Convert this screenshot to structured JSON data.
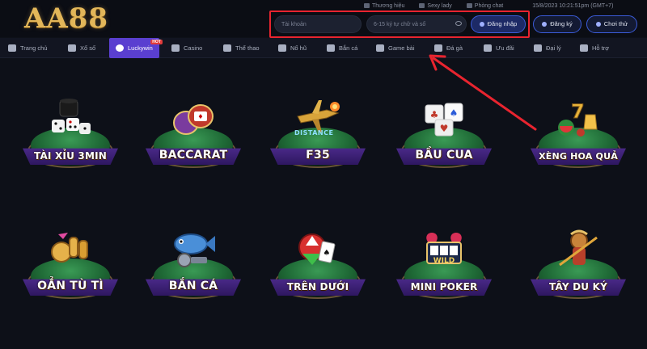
{
  "brand": {
    "logo_text": "AA88"
  },
  "top_links": [
    {
      "label": "Thương hiệu",
      "icon": "tag-icon"
    },
    {
      "label": "Sexy lady",
      "icon": "lady-icon"
    },
    {
      "label": "Phòng chat",
      "icon": "chat-icon"
    }
  ],
  "clock": "15/8/2023 10:21:51pm  (GMT+7)",
  "login": {
    "username_placeholder": "Tài khoản",
    "password_placeholder": "6-15 ký tự chữ và số",
    "login_label": "Đăng nhập",
    "register_label": "Đăng ký",
    "demo_label": "Chơi thử"
  },
  "nav": {
    "items": [
      {
        "label": "Trang chủ",
        "icon": "home-icon"
      },
      {
        "label": "Xổ số",
        "icon": "lottery-icon"
      },
      {
        "label": "Luckywin",
        "icon": "luckywin-icon",
        "badge": "HOT"
      },
      {
        "label": "Casino",
        "icon": "casino-icon"
      },
      {
        "label": "Thể thao",
        "icon": "soccer-icon"
      },
      {
        "label": "Nổ hũ",
        "icon": "slot-icon"
      },
      {
        "label": "Bắn cá",
        "icon": "fish-icon"
      },
      {
        "label": "Game bài",
        "icon": "cards-icon"
      },
      {
        "label": "Đá gà",
        "icon": "rooster-icon"
      },
      {
        "label": "Ưu đãi",
        "icon": "gift-icon"
      },
      {
        "label": "Đại lý",
        "icon": "agent-icon"
      },
      {
        "label": "Hỗ trợ",
        "icon": "support-icon"
      }
    ]
  },
  "games": [
    {
      "label": "TÀI XỈU 3MIN",
      "icon": "dice-cup-icon"
    },
    {
      "label": "BACCARAT",
      "icon": "chips-icon"
    },
    {
      "label": "F35",
      "icon": "jet-icon",
      "extra": "DISTANCE"
    },
    {
      "label": "BẦU CUA",
      "icon": "bau-cua-dice-icon"
    },
    {
      "label": "XÈNG HOA QUẢ",
      "icon": "fruit-slot-icon"
    },
    {
      "label": "OẲN TÙ TÌ",
      "icon": "rock-paper-scissors-icon"
    },
    {
      "label": "BẮN CÁ",
      "icon": "fish-shooter-icon"
    },
    {
      "label": "TRÊN DƯỚI",
      "icon": "hi-lo-cards-icon"
    },
    {
      "label": "MINI POKER",
      "icon": "wild-slot-icon"
    },
    {
      "label": "TÂY DU KÝ",
      "icon": "monkey-king-icon"
    }
  ],
  "colors": {
    "highlight_box": "#e8242f",
    "active_tab": "#5a3fd0",
    "label_ribbon": "#4b2a8a",
    "logo_gold": "#e2b659"
  }
}
